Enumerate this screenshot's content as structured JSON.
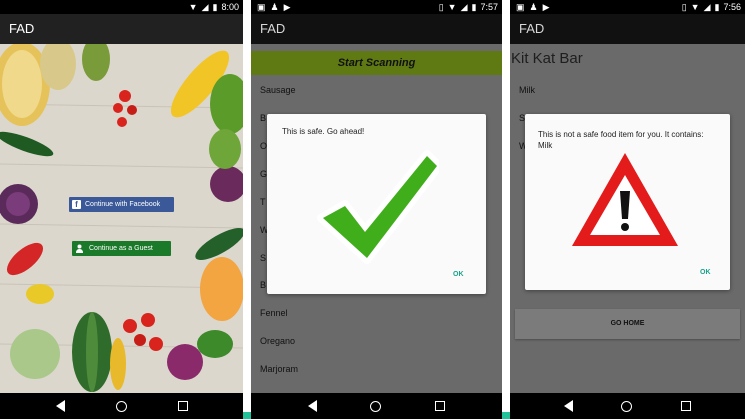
{
  "screens": [
    {
      "status": {
        "time": "8:00"
      },
      "app_title": "FAD",
      "facebook_button": "Continue with Facebook",
      "guest_button": "Continue as a Guest"
    },
    {
      "status": {
        "time": "7:57"
      },
      "app_title": "FAD",
      "scan_button": "Start Scanning",
      "list_items": [
        "Sausage",
        "B",
        "O",
        "G",
        "T",
        "W",
        "S",
        "B",
        "Fennel",
        "Oregano",
        "Marjoram"
      ],
      "dialog": {
        "message": "This is safe. Go ahead!",
        "ok_label": "OK",
        "icon": "checkmark-icon"
      }
    },
    {
      "status": {
        "time": "7:56"
      },
      "app_title": "FAD",
      "product_title": "Kit Kat Bar",
      "list_items": [
        "Milk",
        "S",
        "W"
      ],
      "dialog": {
        "message": "This is not a safe food item for you. It contains: Milk",
        "ok_label": "OK",
        "icon": "warning-icon"
      },
      "go_home_button": "GO HOME"
    }
  ],
  "colors": {
    "facebook_blue": "#3b5998",
    "guest_green": "#1b7a2a",
    "scan_bar": "#8cb31a",
    "check_green": "#3fae1a",
    "warning_red": "#e31b1b",
    "ok_teal": "#1aa38a"
  }
}
